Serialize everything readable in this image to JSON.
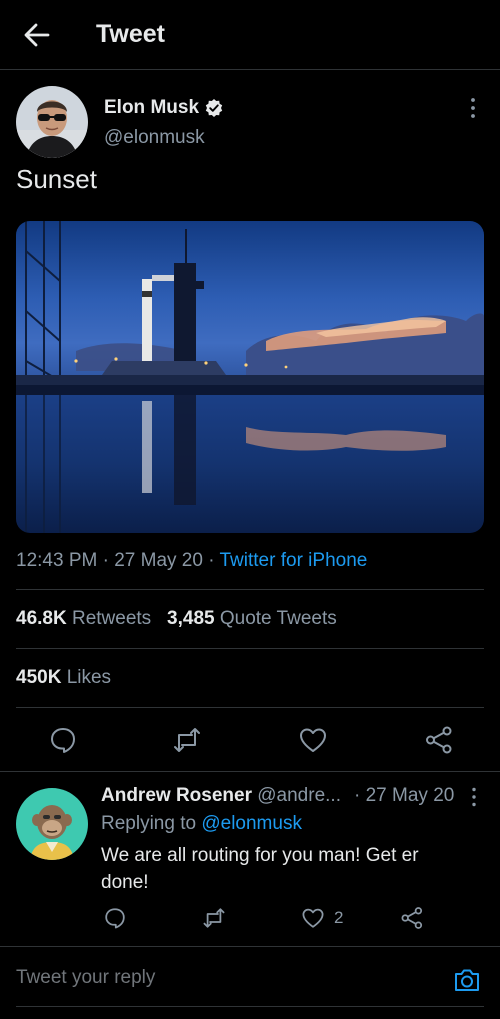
{
  "header": {
    "title": "Tweet",
    "back_icon": "arrow-left-icon"
  },
  "tweet": {
    "author_name": "Elon Musk",
    "author_handle": "@elonmusk",
    "verified_icon": "verified-badge-icon",
    "text": "Sunset",
    "time": "12:43 PM",
    "date": "27 May 20",
    "separator": "·",
    "source": "Twitter for iPhone",
    "retweets_count": "46.8K",
    "retweets_label": "Retweets",
    "quotes_count": "3,485",
    "quotes_label": "Quote Tweets",
    "likes_count": "450K",
    "likes_label": "Likes"
  },
  "actions": [
    "reply-icon",
    "retweet-icon",
    "like-icon",
    "share-icon"
  ],
  "reply": {
    "name": "Andrew Rosener",
    "handle": "@andre...",
    "time": "· 27 May 20",
    "replying_prefix": "Replying to",
    "replying_to": "@elonmusk",
    "text": "We are all routing for you man!  Get er done!",
    "like_count": "2"
  },
  "compose": {
    "placeholder": "Tweet your reply",
    "camera_icon": "camera-icon"
  },
  "colors": {
    "background": "#000000",
    "accent": "#1d9bf0",
    "muted": "#8b98a5",
    "text": "#e7e9ea",
    "divider": "#2f3336"
  }
}
